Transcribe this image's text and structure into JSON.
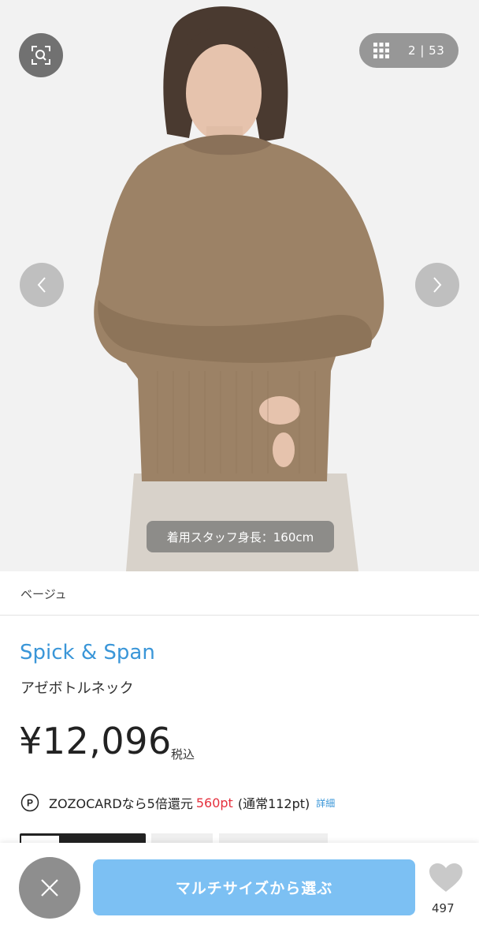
{
  "gallery": {
    "current": "2",
    "separator": "|",
    "total": "53",
    "caption": "着用スタッフ身長：160cm",
    "icons": {
      "zoom": "image-search-icon",
      "grid": "grid-icon",
      "prev": "chevron-left-icon",
      "next": "chevron-right-icon"
    }
  },
  "color_name": "ベージュ",
  "brand": "Spick & Span",
  "product_name": "アゼボトルネック",
  "price": {
    "amount": "¥12,096",
    "tax_label": "税込"
  },
  "points": {
    "icon": "points-p-icon",
    "text": "ZOZOCARDなら5倍還元",
    "points": "560pt",
    "normal": "(通常112pt)",
    "detail_link": "詳細"
  },
  "bottom_bar": {
    "close_icon": "close-icon",
    "select_button": "マルチサイズから選ぶ",
    "like_icon": "heart-icon",
    "like_count": "497"
  },
  "colors": {
    "brand_blue": "#3a96d8",
    "button_blue": "#7cc0f3",
    "points_red": "#e5303d"
  }
}
